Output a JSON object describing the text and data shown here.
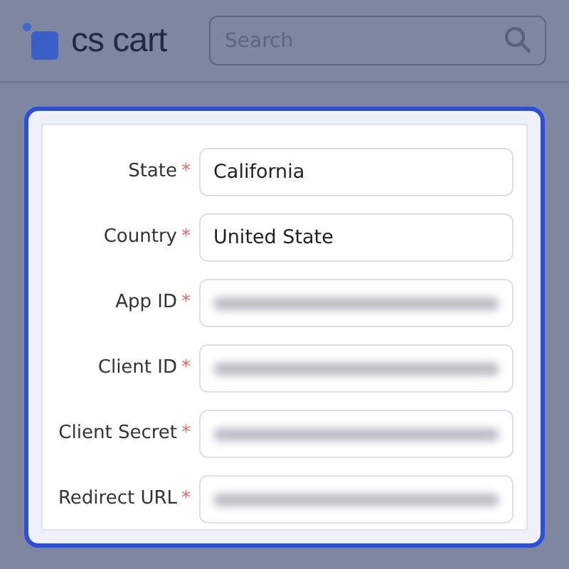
{
  "header": {
    "logo": "cs cart",
    "search": {
      "placeholder": "Search"
    }
  },
  "form": {
    "fields": [
      {
        "label": "State",
        "required_mark": "*",
        "value": "California",
        "blurred": false
      },
      {
        "label": "Country",
        "required_mark": "*",
        "value": "United State",
        "blurred": false
      },
      {
        "label": "App ID",
        "required_mark": "*",
        "blurred": true
      },
      {
        "label": "Client ID",
        "required_mark": "*",
        "blurred": true
      },
      {
        "label": "Client Secret",
        "required_mark": "*",
        "blurred": true
      },
      {
        "label": "Redirect URL",
        "required_mark": "*",
        "blurred": true
      }
    ]
  }
}
